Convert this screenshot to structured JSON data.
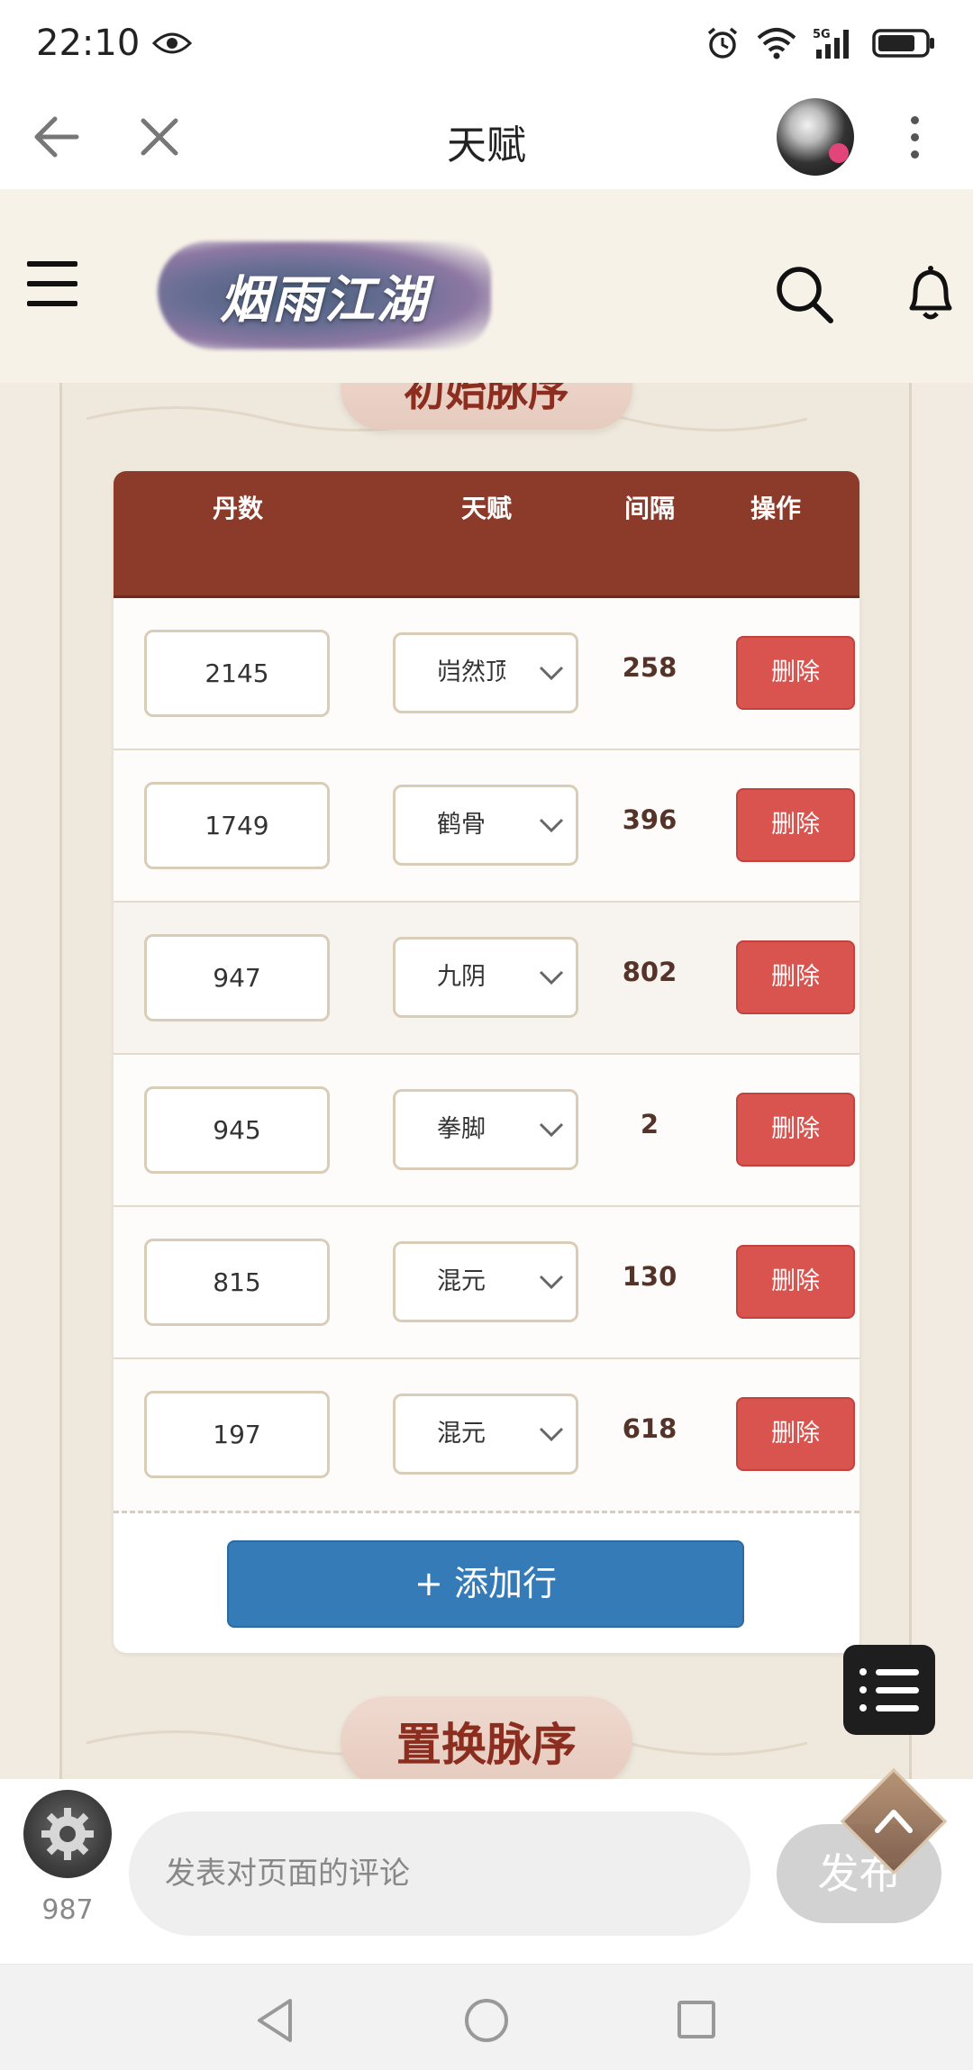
{
  "status_bar": {
    "time": "22:10",
    "network": "5G"
  },
  "browser": {
    "title": "天赋"
  },
  "site": {
    "logo_text": "烟雨江湖"
  },
  "sections": {
    "top_title": "初始脉序",
    "bottom_title": "置换脉序"
  },
  "table": {
    "headers": {
      "dan": "丹数",
      "talent": "天赋",
      "gap": "间隔",
      "op": "操作"
    },
    "rows": [
      {
        "dan": "2145",
        "talent": "岿然顶",
        "gap": "258",
        "action": "删除"
      },
      {
        "dan": "1749",
        "talent": "鹤骨",
        "gap": "396",
        "action": "删除"
      },
      {
        "dan": "947",
        "talent": "九阴",
        "gap": "802",
        "action": "删除"
      },
      {
        "dan": "945",
        "talent": "拳脚",
        "gap": "2",
        "action": "删除"
      },
      {
        "dan": "815",
        "talent": "混元",
        "gap": "130",
        "action": "删除"
      },
      {
        "dan": "197",
        "talent": "混元",
        "gap": "618",
        "action": "删除"
      }
    ],
    "add_row_label": "+ 添加行"
  },
  "comment": {
    "count": "987",
    "placeholder": "发表对页面的评论",
    "publish_label": "发布"
  },
  "colors": {
    "header_bg": "#8c3b2a",
    "delete_btn": "#d9534f",
    "add_btn": "#357bb7",
    "title_text": "#8c2e1f"
  },
  "icons": [
    "eye-icon",
    "alarm-icon",
    "wifi-icon",
    "signal-icon",
    "battery-icon",
    "back-arrow-icon",
    "close-icon",
    "more-icon",
    "menu-icon",
    "search-icon",
    "bell-icon",
    "chevron-down-icon",
    "list-icon",
    "gear-icon",
    "chevron-up-icon"
  ]
}
